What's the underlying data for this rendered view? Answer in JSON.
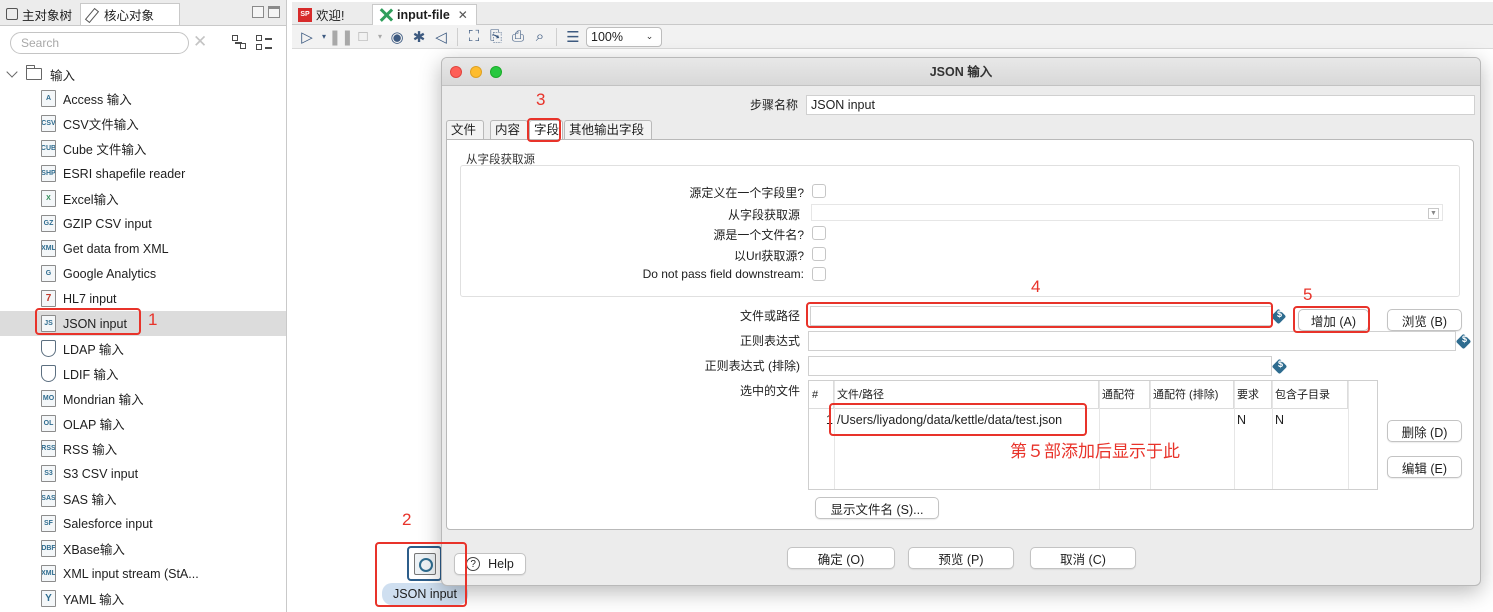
{
  "left_panel": {
    "tabs": [
      "主对象树",
      "核心对象"
    ],
    "search_placeholder": "Search",
    "folder": "输入",
    "items": [
      {
        "label": "Access 输入",
        "icon": "A"
      },
      {
        "label": "CSV文件输入",
        "icon": "CSV"
      },
      {
        "label": "Cube 文件输入",
        "icon": "CUB"
      },
      {
        "label": "ESRI shapefile reader",
        "icon": "SHP"
      },
      {
        "label": "Excel输入",
        "icon": "X"
      },
      {
        "label": "GZIP CSV input",
        "icon": "GZ"
      },
      {
        "label": "Get data from XML",
        "icon": "XML"
      },
      {
        "label": "Google Analytics",
        "icon": "G"
      },
      {
        "label": "HL7 input",
        "icon": "7"
      },
      {
        "label": "JSON input",
        "icon": "JS"
      },
      {
        "label": "LDAP 输入",
        "icon": "LD"
      },
      {
        "label": "LDIF 输入",
        "icon": "LF"
      },
      {
        "label": "Mondrian 输入",
        "icon": "MO"
      },
      {
        "label": "OLAP 输入",
        "icon": "OL"
      },
      {
        "label": "RSS 输入",
        "icon": "RSS"
      },
      {
        "label": "S3 CSV input",
        "icon": "S3"
      },
      {
        "label": "SAS 输入",
        "icon": "SAS"
      },
      {
        "label": "Salesforce input",
        "icon": "SF"
      },
      {
        "label": "XBase输入",
        "icon": "DBF"
      },
      {
        "label": "XML input stream (StA...",
        "icon": "XML"
      },
      {
        "label": "YAML 输入",
        "icon": "Y"
      }
    ]
  },
  "editor": {
    "tabs": [
      "欢迎!",
      "input-file"
    ],
    "zoom": "100%",
    "welcome_icon": "SP",
    "canvas_step_label": "JSON input"
  },
  "dialog": {
    "title": "JSON 输入",
    "step_name_label": "步骤名称",
    "step_name_value": "JSON input",
    "tabs": [
      "文件",
      "内容",
      "字段",
      "其他输出字段"
    ],
    "group_title": "从字段获取源",
    "labels": {
      "source_in_field": "源定义在一个字段里?",
      "source_field": "从字段获取源",
      "source_is_file": "源是一个文件名?",
      "source_url": "以Url获取源?",
      "no_pass": "Do not pass field downstream:",
      "file_path": "文件或路径",
      "regex": "正则表达式",
      "regex_exclude": "正则表达式 (排除)",
      "selected_files": "选中的文件"
    },
    "buttons": {
      "add": "增加 (A)",
      "browse": "浏览 (B)",
      "delete": "删除 (D)",
      "edit": "编辑 (E)",
      "show_files": "显示文件名 (S)...",
      "ok": "确定 (O)",
      "preview": "预览 (P)",
      "cancel": "取消 (C)",
      "help": "Help"
    },
    "table": {
      "headers": [
        "#",
        "文件/路径",
        "通配符",
        "通配符 (排除)",
        "要求",
        "包含子目录"
      ],
      "rows": [
        {
          "num": "1",
          "path": "/Users/liyadong/data/kettle/data/test.json",
          "wildcard": "",
          "exclude": "",
          "required": "N",
          "subdirs": "N"
        }
      ]
    }
  },
  "annotations": {
    "n1": "1",
    "n2": "2",
    "n3": "3",
    "n4": "4",
    "n5": "5",
    "note": "第５部添加后显示于此",
    "color": "#e8332a"
  }
}
